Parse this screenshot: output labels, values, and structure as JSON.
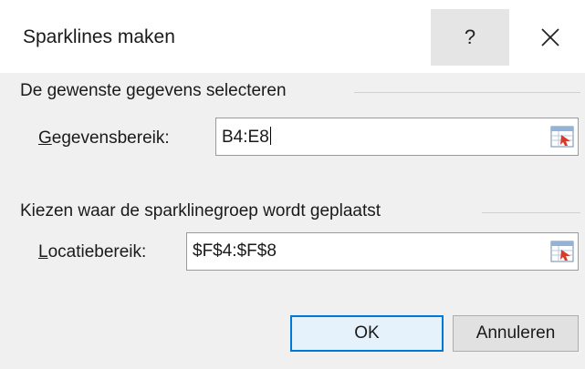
{
  "dialog": {
    "title": "Sparklines maken",
    "help_label": "?",
    "close_icon": "close-icon"
  },
  "data_section": {
    "heading": "De gewenste gegevens selecteren",
    "field_label_mnemonic": "G",
    "field_label_rest": "egevensbereik:",
    "field_value": "B4:E8",
    "picker_icon": "range-picker-icon"
  },
  "location_section": {
    "heading": "Kiezen waar de sparklinegroep wordt geplaatst",
    "field_label_mnemonic": "L",
    "field_label_rest": "ocatiebereik:",
    "field_value": "$F$4:$F$8",
    "picker_icon": "range-picker-icon"
  },
  "buttons": {
    "ok_label": "OK",
    "cancel_label": "Annuleren"
  },
  "colors": {
    "accent": "#0078d7",
    "dialog_bg": "#f0f0f0"
  }
}
